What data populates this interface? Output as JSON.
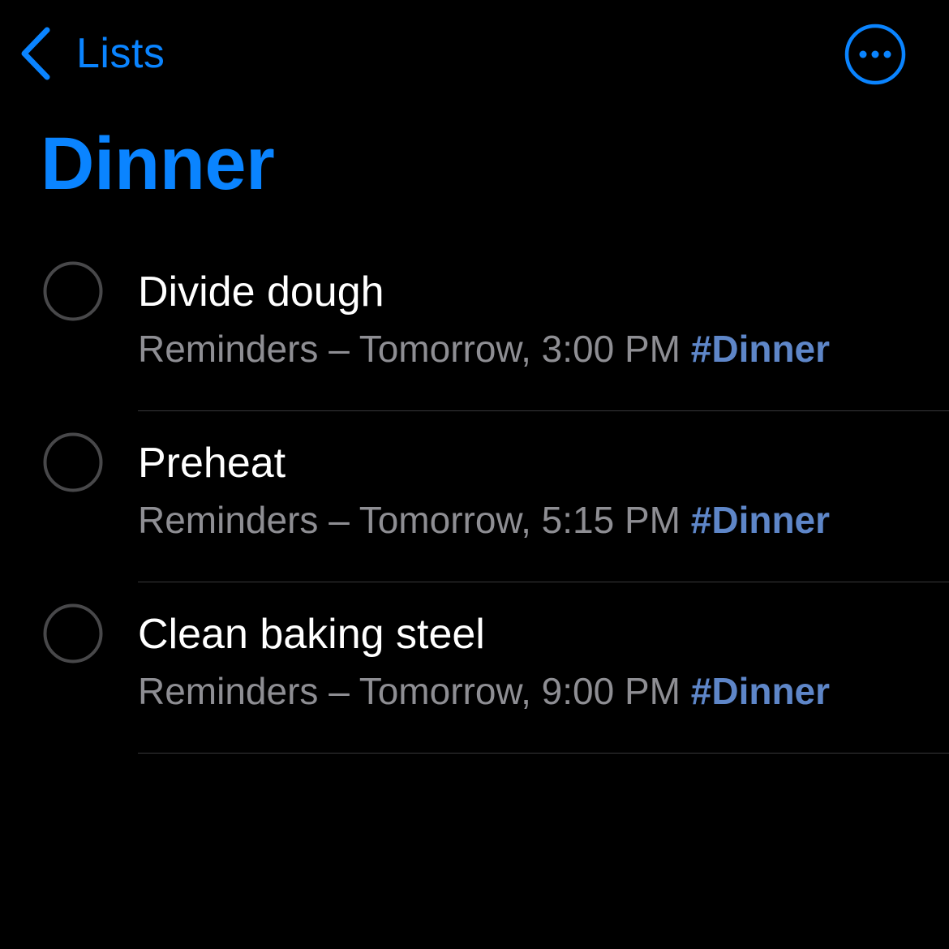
{
  "nav": {
    "back_label": "Lists",
    "back_icon": "chevron-left-icon",
    "more_icon": "ellipsis-circle-icon"
  },
  "page": {
    "title": "Dinner"
  },
  "colors": {
    "accent": "#0a84ff",
    "tag": "#5e86c8",
    "secondary_text": "#8e8e93",
    "background": "#000000"
  },
  "reminders": [
    {
      "title": "Divide dough",
      "meta": "Reminders – Tomorrow, 3:00 PM",
      "tag": "#Dinner"
    },
    {
      "title": "Preheat",
      "meta": "Reminders – Tomorrow, 5:15 PM",
      "tag": "#Dinner"
    },
    {
      "title": "Clean baking steel",
      "meta": "Reminders – Tomorrow, 9:00 PM",
      "tag": "#Dinner"
    }
  ]
}
